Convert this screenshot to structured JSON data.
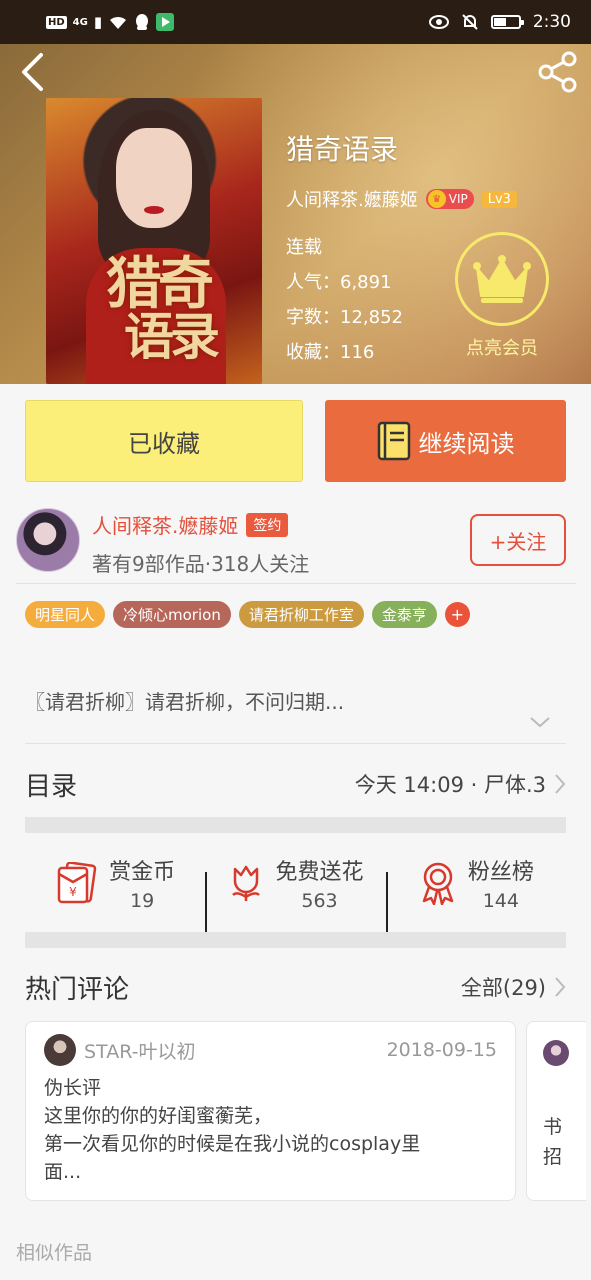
{
  "status_bar": {
    "hd": "HD",
    "network": "4G",
    "time": "2:30"
  },
  "book": {
    "title": "猎奇语录",
    "cover_title_line1": "猎奇",
    "cover_title_line2": "语录",
    "author": "人间释茶.嬷藤姬",
    "vip_label": "VIP",
    "level": "Lv3",
    "status": "连载",
    "popularity": "人气：6,891",
    "word_count": "字数：12,852",
    "favorites": "收藏：116"
  },
  "member": {
    "label": "点亮会员"
  },
  "actions": {
    "favorited_label": "已收藏",
    "continue_label": "继续阅读"
  },
  "author_block": {
    "name": "人间释茶.嬷藤姬",
    "sign_badge": "签约",
    "stats": "著有9部作品·318人关注",
    "follow_label": "+关注"
  },
  "tags": [
    {
      "label": "明星同人",
      "color": "#f4ad3d"
    },
    {
      "label": "冷倾心morion",
      "color": "#b7675a"
    },
    {
      "label": "请君折柳工作室",
      "color": "#cc9a3f"
    },
    {
      "label": "金泰亨",
      "color": "#86b05a"
    }
  ],
  "tag_more": "+",
  "intro": "〖请君折柳〗请君折柳，不问归期...",
  "catalog": {
    "label": "目录",
    "update": "今天 14:09 · 尸体.3"
  },
  "rewards": [
    {
      "label": "赏金币",
      "count": "19",
      "icon": "red-envelope-icon"
    },
    {
      "label": "免费送花",
      "count": "563",
      "icon": "flower-icon"
    },
    {
      "label": "粉丝榜",
      "count": "144",
      "icon": "medal-icon"
    }
  ],
  "hot_comments": {
    "label": "热门评论",
    "all": "全部(29)",
    "items": [
      {
        "user": "STAR-叶以初",
        "date": "2018-09-15",
        "line1": "伪长评",
        "line2": "这里你的你的好闺蜜蘅芜，",
        "line3": "第一次看见你的时候是在我小说的cosplay里",
        "line4": "面..."
      }
    ],
    "peek_text": "书招"
  },
  "similar_label": "相似作品",
  "colors": {
    "accent_orange": "#ea6b3e",
    "fav_yellow": "#fbef7a",
    "author_red": "#e4503c",
    "member_yellow": "#f7e96b"
  }
}
